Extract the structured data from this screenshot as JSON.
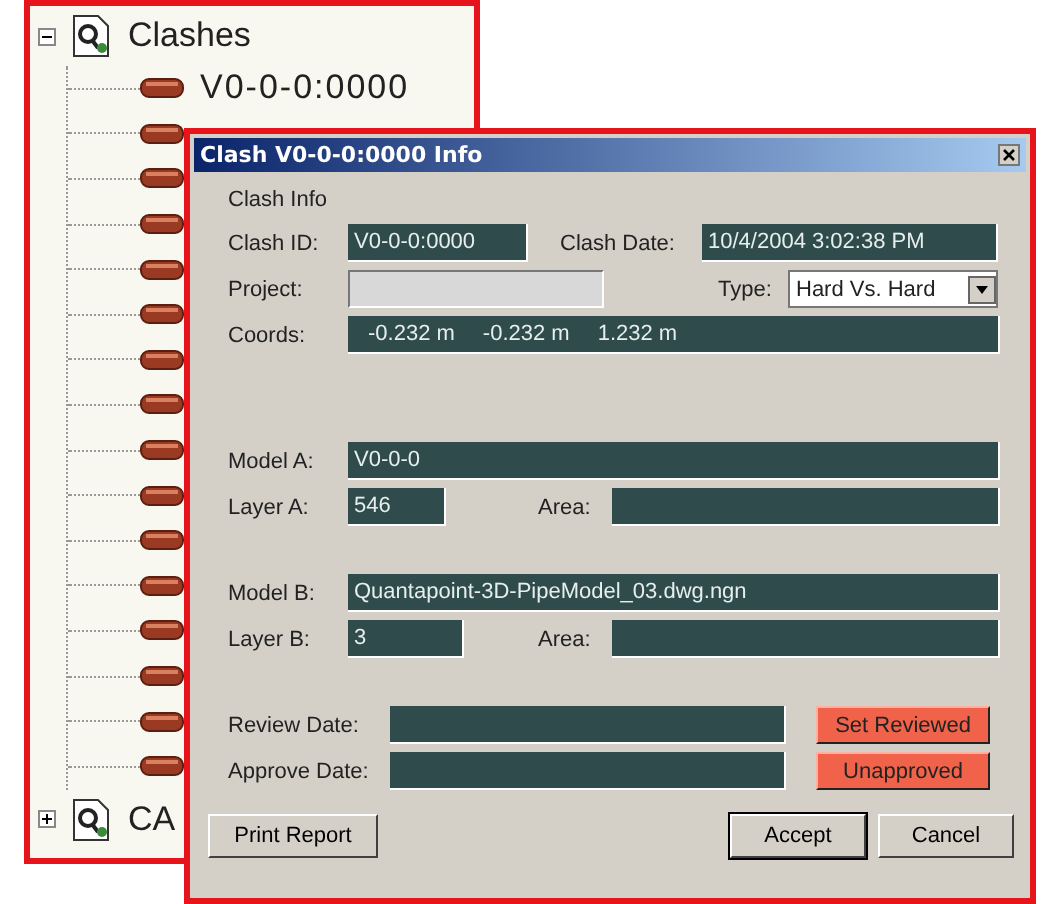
{
  "tree": [
    {
      "label": "Clashes",
      "expanded": true,
      "children": [
        {
          "kind": "clash",
          "label": "V0-0-0:0000"
        },
        {
          "kind": "clash"
        },
        {
          "kind": "clash"
        },
        {
          "kind": "clash"
        },
        {
          "kind": "clash"
        },
        {
          "kind": "clash"
        },
        {
          "kind": "clash"
        },
        {
          "kind": "clash"
        },
        {
          "kind": "clash"
        },
        {
          "kind": "clash"
        },
        {
          "kind": "clash"
        },
        {
          "kind": "clash"
        },
        {
          "kind": "clash"
        },
        {
          "kind": "clash"
        },
        {
          "kind": "clash"
        },
        {
          "kind": "clash"
        }
      ]
    },
    {
      "label": "CA",
      "expanded": false
    }
  ],
  "dialog": {
    "title": "Clash V0-0-0:0000 Info",
    "section": "Clash Info",
    "clash_id": {
      "label": "Clash ID:",
      "value": "V0-0-0:0000"
    },
    "clash_date": {
      "label": "Clash Date:",
      "value": "10/4/2004 3:02:38 PM"
    },
    "project": {
      "label": "Project:",
      "disabled": true
    },
    "type": {
      "label": "Type:",
      "value": "Hard Vs. Hard"
    },
    "coords": {
      "label": "Coords:",
      "values": [
        "-0.232 m",
        "-0.232 m",
        "1.232 m"
      ]
    },
    "model_a": {
      "label": "Model A:",
      "value": "V0-0-0"
    },
    "layer_a": {
      "label": "Layer A:",
      "value": "546"
    },
    "area_a": {
      "label": "Area:"
    },
    "model_b": {
      "label": "Model B:",
      "value": "Quantapoint-3D-PipeModel_03.dwg.ngn"
    },
    "layer_b": {
      "label": "Layer B:",
      "value": "3"
    },
    "area_b": {
      "label": "Area:"
    },
    "review_date": {
      "label": "Review Date:"
    },
    "approve_date": {
      "label": "Approve Date:"
    },
    "status_buttons": [
      {
        "label": "Set Reviewed"
      },
      {
        "label": "Unapproved"
      }
    ],
    "footer_buttons": [
      {
        "label": "Print Report",
        "default": false
      },
      {
        "label": "Accept",
        "default": true
      },
      {
        "label": "Cancel",
        "default": false
      }
    ]
  }
}
